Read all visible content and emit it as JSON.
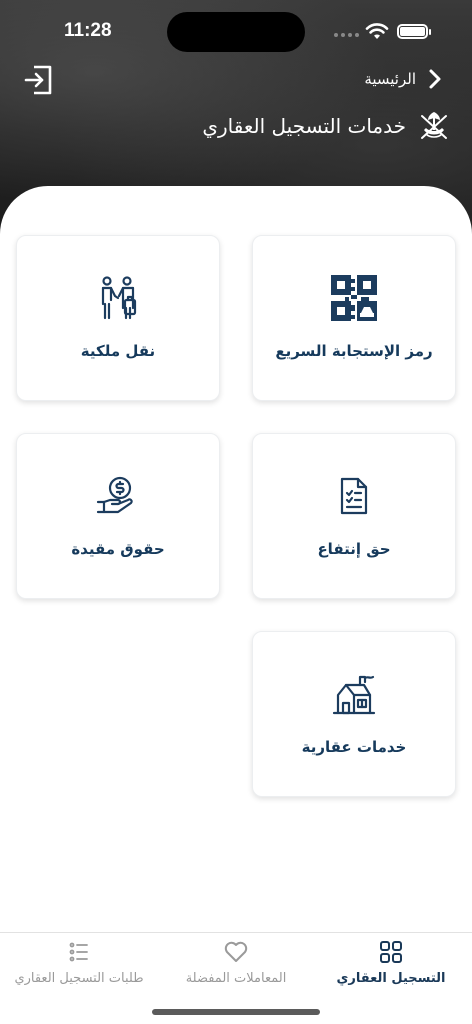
{
  "status_bar": {
    "time": "11:28"
  },
  "header": {
    "breadcrumb": "الرئيسية",
    "title": "خدمات التسجيل العقاري"
  },
  "services": [
    {
      "label": "رمز الإستجابة السريع",
      "icon": "qr-code-icon"
    },
    {
      "label": "نقل ملكية",
      "icon": "ownership-transfer-icon"
    },
    {
      "label": "حق إنتفاع",
      "icon": "usufruct-document-icon"
    },
    {
      "label": "حقوق مقيدة",
      "icon": "restricted-rights-icon"
    },
    {
      "label": "خدمات عقارية",
      "icon": "real-estate-house-icon"
    }
  ],
  "tabs": [
    {
      "label": "التسجيل العقاري",
      "icon": "grid-icon",
      "active": true
    },
    {
      "label": "المعاملات المفضلة",
      "icon": "heart-icon",
      "active": false
    },
    {
      "label": "طلبات التسجيل العقاري",
      "icon": "list-icon",
      "active": false
    }
  ],
  "colors": {
    "primary": "#163a5c",
    "inactive": "#9a9a9a"
  }
}
